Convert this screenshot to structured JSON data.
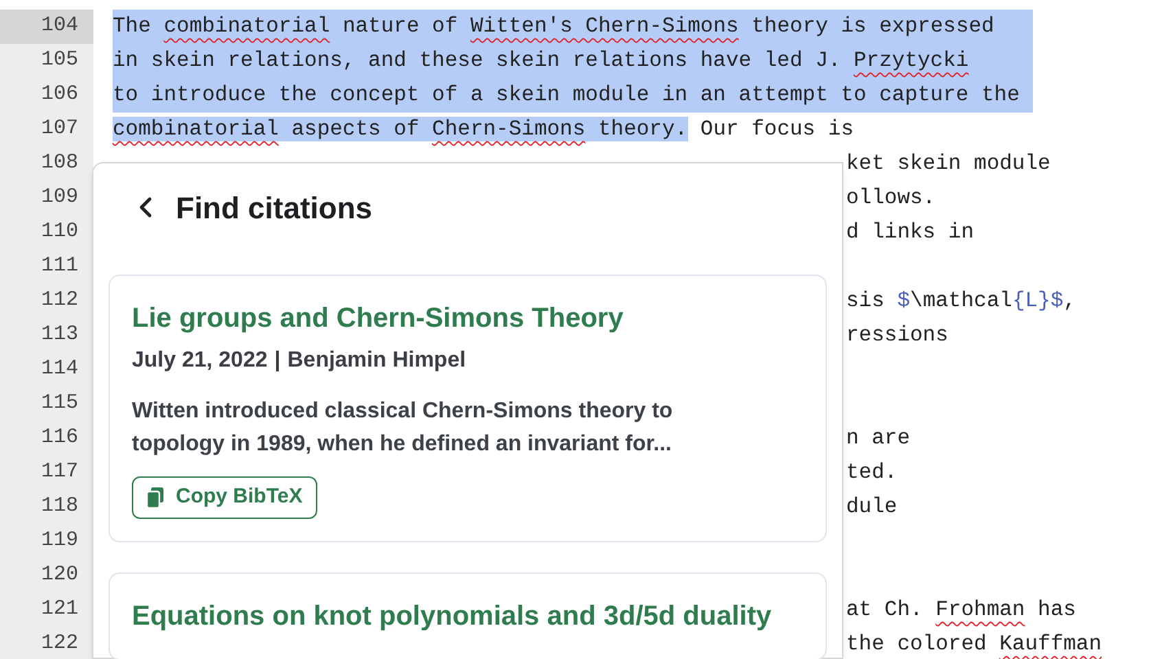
{
  "editor": {
    "lines": [
      {
        "number": "104",
        "active": true,
        "kind": "full",
        "selected": true,
        "segments": [
          {
            "text": "The "
          },
          {
            "text": "combinatorial",
            "misspelled": true
          },
          {
            "text": " nature of "
          },
          {
            "text": "Witten's Chern-Simons",
            "misspelled": true
          },
          {
            "text": " theory is expressed"
          }
        ]
      },
      {
        "number": "105",
        "active": false,
        "kind": "full",
        "selected": true,
        "segments": [
          {
            "text": "in skein relations, and these skein relations have led J. "
          },
          {
            "text": "Przytycki",
            "misspelled": true
          }
        ]
      },
      {
        "number": "106",
        "active": false,
        "kind": "full",
        "selected": true,
        "segments": [
          {
            "text": "to introduce the concept of a skein module in an attempt to capture the"
          }
        ]
      },
      {
        "number": "107",
        "active": false,
        "kind": "full",
        "selected": false,
        "segments": [
          {
            "text": "combinatorial",
            "misspelled": true,
            "selected": true
          },
          {
            "text": " aspects of ",
            "selected": true
          },
          {
            "text": "Chern-Simons",
            "misspelled": true,
            "selected": true
          },
          {
            "text": " theory.",
            "selected": true
          },
          {
            "text": " Our focus is",
            "selected": false
          }
        ]
      },
      {
        "number": "108",
        "active": false,
        "kind": "tail",
        "segments": [
          {
            "text": "ket skein module"
          }
        ]
      },
      {
        "number": "109",
        "active": false,
        "kind": "tail",
        "segments": [
          {
            "text": "ollows."
          }
        ]
      },
      {
        "number": "110",
        "active": false,
        "kind": "tail",
        "segments": [
          {
            "text": "d links in"
          }
        ]
      },
      {
        "number": "111",
        "active": false,
        "kind": "tail"
      },
      {
        "number": "112",
        "active": false,
        "kind": "tail",
        "segments": [
          {
            "text": "sis "
          },
          {
            "text": "$",
            "math": true
          },
          {
            "text": "\\mathcal"
          },
          {
            "text": "{L}",
            "math": true
          },
          {
            "text": "$",
            "math": true
          },
          {
            "text": ","
          }
        ]
      },
      {
        "number": "113",
        "active": false,
        "kind": "tail",
        "segments": [
          {
            "text": "ressions"
          }
        ]
      },
      {
        "number": "114",
        "active": false,
        "kind": "tail"
      },
      {
        "number": "115",
        "active": false,
        "kind": "tail"
      },
      {
        "number": "116",
        "active": false,
        "kind": "tail",
        "segments": [
          {
            "text": "n are"
          }
        ]
      },
      {
        "number": "117",
        "active": false,
        "kind": "tail",
        "segments": [
          {
            "text": "ted."
          }
        ]
      },
      {
        "number": "118",
        "active": false,
        "kind": "tail",
        "segments": [
          {
            "text": "dule"
          }
        ]
      },
      {
        "number": "119",
        "active": false,
        "kind": "tail"
      },
      {
        "number": "120",
        "active": false,
        "kind": "tail"
      },
      {
        "number": "121",
        "active": false,
        "kind": "tail",
        "segments": [
          {
            "text": "at Ch. "
          },
          {
            "text": "Frohman",
            "misspelled": true
          },
          {
            "text": " has"
          }
        ]
      },
      {
        "number": "122",
        "active": false,
        "kind": "tail",
        "segments": [
          {
            "text": "the colored "
          },
          {
            "text": "Kauffman",
            "misspelled": true
          }
        ]
      }
    ]
  },
  "citations_panel": {
    "title": "Find citations",
    "results": [
      {
        "title": "Lie groups and Chern-Simons Theory",
        "date": "July 21, 2022",
        "separator": "|",
        "author": "Benjamin Himpel",
        "abstract": "Witten introduced classical Chern-Simons theory to topology in 1989, when he defined an invariant for...",
        "button": "Copy BibTeX"
      },
      {
        "title": "Equations on knot polynomials and 3d/5d duality"
      }
    ]
  }
}
